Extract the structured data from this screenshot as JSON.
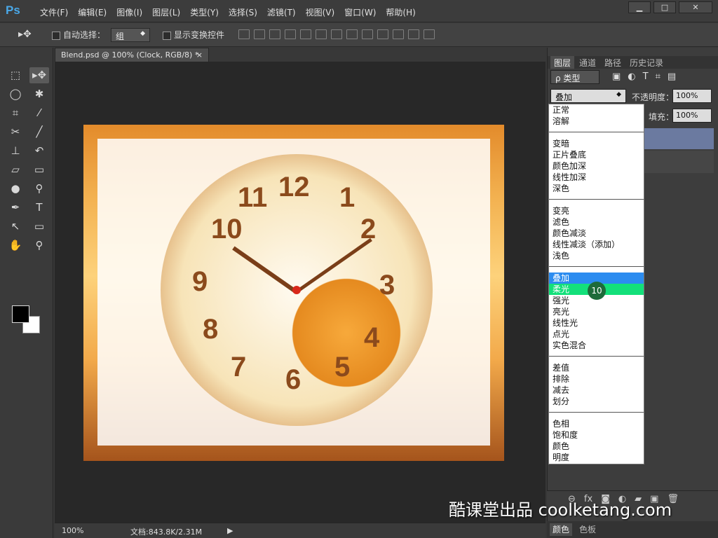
{
  "app": {
    "logo": "Ps"
  },
  "menu": [
    "文件(F)",
    "编辑(E)",
    "图像(I)",
    "图层(L)",
    "类型(Y)",
    "选择(S)",
    "滤镜(T)",
    "视图(V)",
    "窗口(W)",
    "帮助(H)"
  ],
  "window_buttons": {
    "minimize": "▁",
    "maximize": "□",
    "close": "✕"
  },
  "options_bar": {
    "auto_select_label": "自动选择：",
    "auto_select_value": "组",
    "show_transform_label": "显示变换控件"
  },
  "document": {
    "tab_title": "Blend.psd @ 100% (Clock, RGB/8) *",
    "close": "×",
    "numerals": [
      "12",
      "2",
      "3",
      "4",
      "5",
      "6",
      "7",
      "8",
      "9",
      "10",
      "11",
      "1"
    ]
  },
  "status": {
    "zoom": "100%",
    "doc_info": "文档:843.8K/2.31M"
  },
  "layers_panel": {
    "tabs": [
      "图层",
      "通道",
      "路径",
      "历史记录"
    ],
    "filter_label": "ρ 类型",
    "blend_mode": "叠加",
    "opacity_label": "不透明度：",
    "opacity_value": "100%",
    "fill_label": "填充：",
    "fill_value": "100%"
  },
  "blend_menu": {
    "groups": [
      [
        "正常",
        "溶解"
      ],
      [
        "变暗",
        "正片叠底",
        "颜色加深",
        "线性加深",
        "深色"
      ],
      [
        "变亮",
        "滤色",
        "颜色减淡",
        "线性减淡（添加）",
        "浅色"
      ],
      [
        "叠加",
        "柔光",
        "强光",
        "亮光",
        "线性光",
        "点光",
        "实色混合"
      ],
      [
        "差值",
        "排除",
        "减去",
        "划分"
      ],
      [
        "色相",
        "饱和度",
        "颜色",
        "明度"
      ]
    ],
    "highlighted": "叠加",
    "hovered": "柔光"
  },
  "step_badge": "10",
  "bottom_tabs": [
    "颜色",
    "色板"
  ],
  "watermark": "酷课堂出品 coolketang.com",
  "colors": {
    "accent": "#2c8cf0",
    "hover": "#13e07a",
    "badge": "#1e6b3a"
  }
}
